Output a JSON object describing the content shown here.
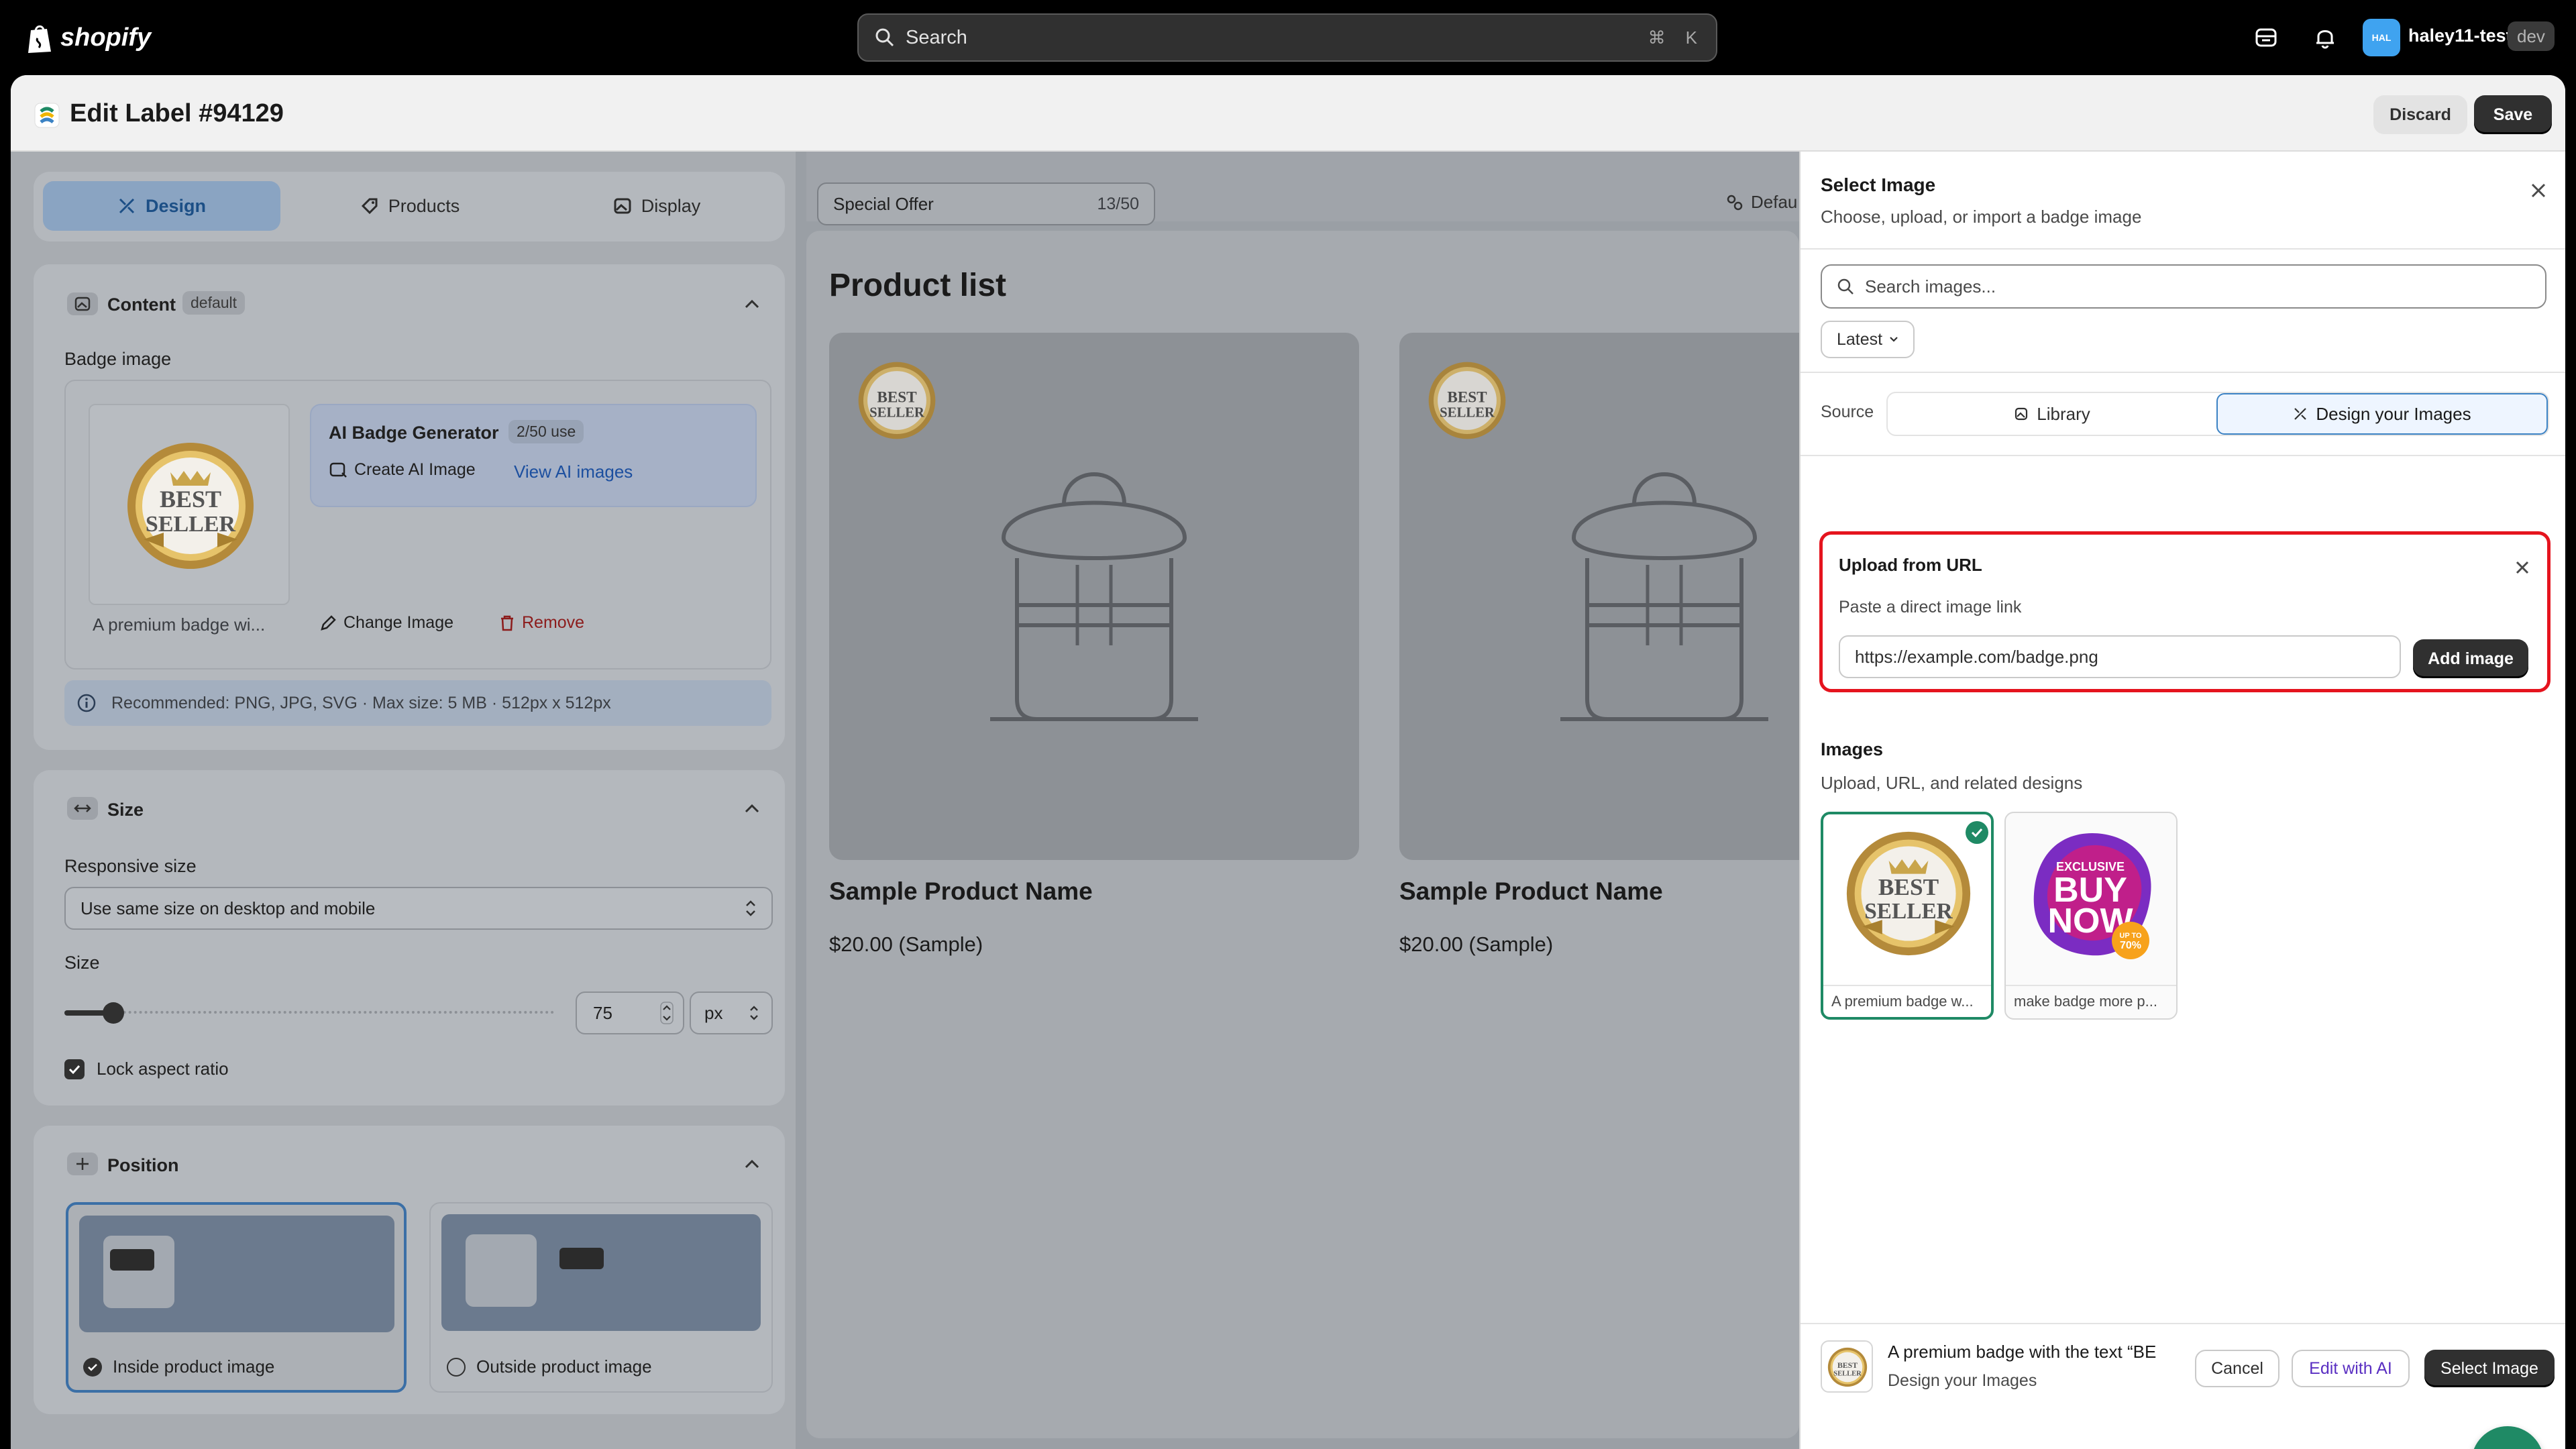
{
  "topbar": {
    "brand": "shopify",
    "search_placeholder": "Search",
    "shortcut_cmd": "⌘",
    "shortcut_key": "K",
    "avatar_initials": "HAL",
    "username": "haley11-test",
    "env_tag": "dev"
  },
  "header": {
    "title": "Edit Label #94129",
    "discard": "Discard",
    "save": "Save"
  },
  "tabs": [
    {
      "label": "Design"
    },
    {
      "label": "Products"
    },
    {
      "label": "Display"
    }
  ],
  "content": {
    "title": "Content",
    "tag": "default",
    "badge_image_label": "Badge image",
    "badge_caption": "A premium badge wi...",
    "ai_title": "AI Badge Generator",
    "ai_usage": "2/50 use",
    "create_ai": "Create AI Image",
    "view_ai": "View AI images",
    "change_image": "Change Image",
    "remove": "Remove",
    "recommend": "Recommended: PNG, JPG, SVG · Max size: 5 MB · 512px x 512px"
  },
  "size": {
    "title": "Size",
    "responsive_label": "Responsive size",
    "responsive_value": "Use same size on desktop and mobile",
    "size_label": "Size",
    "size_value": "75",
    "unit": "px",
    "slider_fraction": 0.1,
    "lock_label": "Lock aspect ratio"
  },
  "position": {
    "title": "Position",
    "inside": "Inside product image",
    "outside": "Outside product image"
  },
  "preview": {
    "label_text": "Special Offer",
    "label_count": "13/50",
    "default_btn": "Defau",
    "list_title": "Product list",
    "products": [
      {
        "name": "Sample Product Name",
        "price": "$20.00 (Sample)"
      },
      {
        "name": "Sample Product Name",
        "price": "$20.00 (Sample)"
      }
    ]
  },
  "picker": {
    "title": "Select Image",
    "subtitle": "Choose, upload, or import a badge image",
    "search_placeholder": "Search images...",
    "sort": "Latest",
    "source_label": "Source",
    "source_library": "Library",
    "source_design": "Design your Images",
    "url_title": "Upload from URL",
    "url_help": "Paste a direct image link",
    "url_value": "https://example.com/badge.png",
    "add_image": "Add image",
    "images_title": "Images",
    "images_sub": "Upload, URL, and related designs",
    "images": [
      {
        "caption": "A premium badge w..."
      },
      {
        "caption": "make badge more p..."
      }
    ],
    "footer_title": "A premium badge with the text “BE",
    "footer_sub": "Design your Images",
    "cancel": "Cancel",
    "edit_ai": "Edit with AI",
    "select": "Select Image"
  },
  "badges": {
    "best_line1": "BEST",
    "best_line2": "SELLER",
    "buy_small": "EXCLUSIVE",
    "buy_line1": "BUY",
    "buy_line2": "NOW",
    "buy_sticker1": "UP TO",
    "buy_sticker2": "70%"
  },
  "colors": {
    "accent_blue": "#3b82c4",
    "highlight_red": "#e5141e",
    "success_green": "#1f8a65",
    "chat_green": "#1f8a65"
  }
}
